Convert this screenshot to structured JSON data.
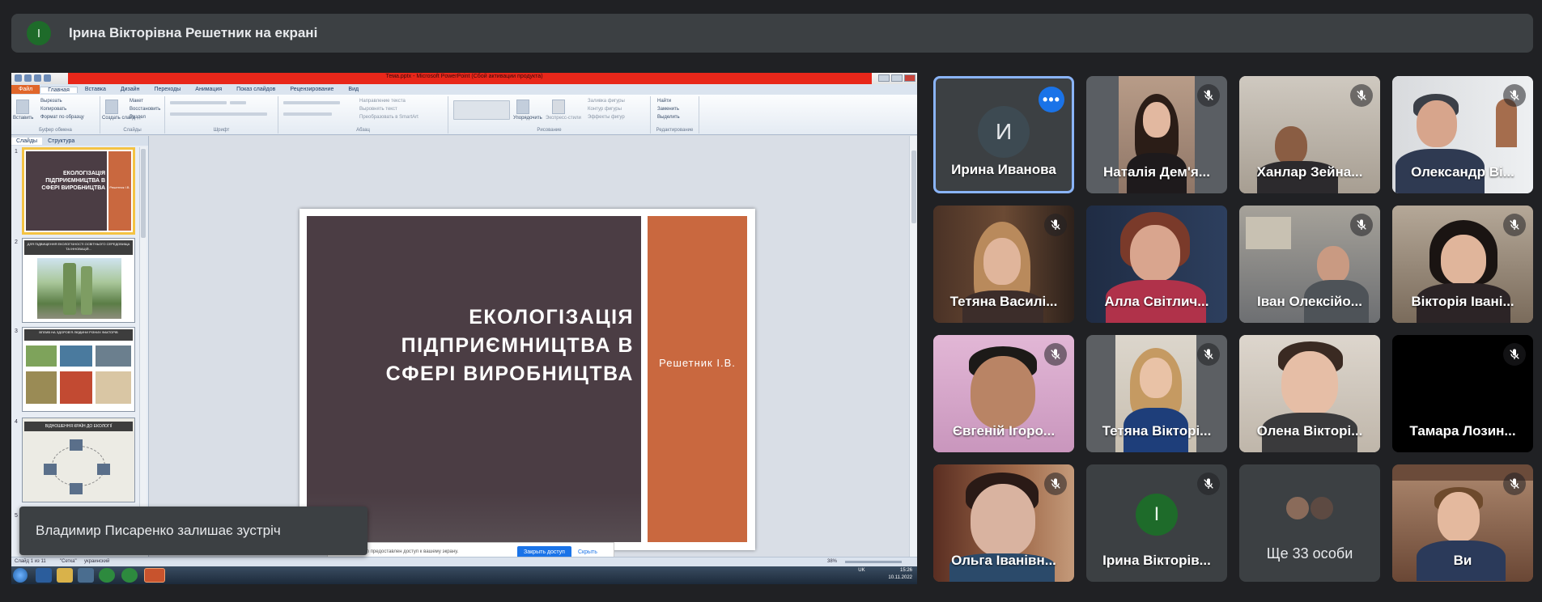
{
  "banner": {
    "avatar_letter": "І",
    "avatar_color": "#1e6b2a",
    "text": "Ірина Вікторівна Решетник на екрані"
  },
  "powerpoint": {
    "window_title": "Тема.pptx - Microsoft PowerPoint (Сбой активации продукта)",
    "tabs": [
      "Файл",
      "Главная",
      "Вставка",
      "Дизайн",
      "Переходы",
      "Анимация",
      "Показ слайдов",
      "Рецензирование",
      "Вид"
    ],
    "ribbon": {
      "clipboard": {
        "label": "Буфер обмена",
        "paste": "Вставить",
        "cut": "Вырезать",
        "copy": "Копировать",
        "format": "Формат по образцу"
      },
      "slides": {
        "label": "Слайды",
        "create": "Создать слайд",
        "layout": "Макет",
        "reset": "Восстановить",
        "section": "Раздел"
      },
      "font": {
        "label": "Шрифт"
      },
      "paragraph": {
        "label": "Абзац",
        "direction": "Направление текста",
        "align": "Выровнять текст",
        "smartart": "Преобразовать в SmartArt"
      },
      "drawing": {
        "label": "Рисование",
        "arrange": "Упорядочить",
        "quick": "Экспресс-стили",
        "fill": "Заливка фигуры",
        "outline": "Контур фигуры",
        "effects": "Эффекты фигур"
      },
      "editing": {
        "label": "Редактирование",
        "find": "Найти",
        "replace": "Заменить",
        "select": "Выделить"
      }
    },
    "pane_tabs": [
      "Слайды",
      "Структура"
    ],
    "thumbnails": [
      {
        "num": "1",
        "title": "ЕКОЛОГІЗАЦІЯ ПІДПРИЄМНИЦТВА В СФЕРІ ВИРОБНИЦТВА",
        "author": "Решетник І.В."
      },
      {
        "num": "2",
        "title": "ДЛЯ ПІДВИЩЕННЯ ЕКОЛОГІЧНОСТІ ОСВІТНЬОГО СЕРЕДОВИЩА ТА ІННОВАЦІЙ..."
      },
      {
        "num": "3",
        "title": "ВПЛИВ НА ЗДОРОВ'Я ЛЮДИНИ РІЗНИХ ФАКТОРІВ"
      },
      {
        "num": "4",
        "title": "ВІДНОШЕННЯ КРАЇН ДО ЕКОЛОГІЇ"
      },
      {
        "num": "5"
      }
    ],
    "slide": {
      "title": "ЕКОЛОГІЗАЦІЯ ПІДПРИЄМНИЦТВА В СФЕРІ ВИРОБНИЦТВА",
      "author": "Решетник І.В.",
      "dark_color": "#4b3d44",
      "accent_color": "#c9683f"
    },
    "share_bar": {
      "message": "meet.google.com предоставлен доступ к вашему экрану.",
      "stop_button": "Закрыть доступ",
      "hide_link": "Скрыть"
    },
    "status": {
      "slide_info": "Слайд 1 из 11",
      "theme": "\"Сетка\"",
      "language": "украинский",
      "zoom": "38%"
    },
    "taskbar": {
      "lang": "UK",
      "time": "15:26",
      "date": "10.11.2022"
    }
  },
  "toast": {
    "text": "Владимир Писаренко залишає зустріч"
  },
  "participants": [
    {
      "name": "Ирина Иванова",
      "avatar_letter": "И",
      "active": true,
      "muted": false
    },
    {
      "name": "Наталія Дем'я...",
      "muted": true
    },
    {
      "name": "Ханлар Зейна...",
      "muted": true
    },
    {
      "name": "Олександр Ві...",
      "muted": true
    },
    {
      "name": "Тетяна Василі...",
      "muted": true
    },
    {
      "name": "Алла Світлич...",
      "muted": false
    },
    {
      "name": "Іван Олексійо...",
      "muted": true
    },
    {
      "name": "Вікторія Івані...",
      "muted": true
    },
    {
      "name": "Євгеній Ігоро...",
      "muted": true
    },
    {
      "name": "Тетяна Вікторі...",
      "muted": true
    },
    {
      "name": "Олена Вікторі...",
      "muted": false
    },
    {
      "name": "Тамара Лозин...",
      "muted": true
    },
    {
      "name": "Ольга Іванівн...",
      "muted": true
    },
    {
      "name": "Ірина Вікторів...",
      "avatar_letter": "І",
      "muted": true
    },
    {
      "name": "Ще 33 особи",
      "muted": false
    },
    {
      "name": "Ви",
      "muted": true
    }
  ]
}
